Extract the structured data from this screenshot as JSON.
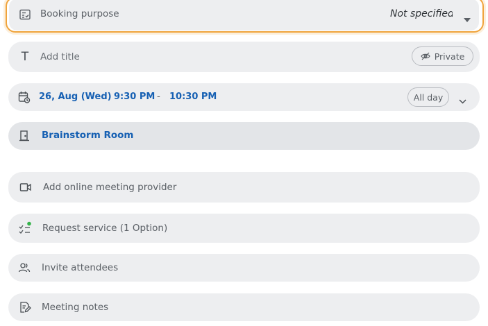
{
  "booking_purpose": {
    "label": "Booking purpose",
    "value": "Not specified"
  },
  "title": {
    "placeholder": "Add title",
    "private_label": "Private"
  },
  "datetime": {
    "date": "26, Aug (Wed)",
    "start": "9:30 PM",
    "separator": "-",
    "end": "10:30 PM",
    "all_day_label": "All day"
  },
  "room": {
    "name": "Brainstorm Room"
  },
  "online_meeting": {
    "label": "Add online meeting provider"
  },
  "service": {
    "label": "Request service (1 Option)"
  },
  "attendees": {
    "label": "Invite attendees"
  },
  "notes": {
    "label": "Meeting notes"
  },
  "colors": {
    "focus_border": "#f0a43c",
    "accent_blue": "#1660b3",
    "row_bg": "#edeef0",
    "status_green": "#34b34a"
  }
}
